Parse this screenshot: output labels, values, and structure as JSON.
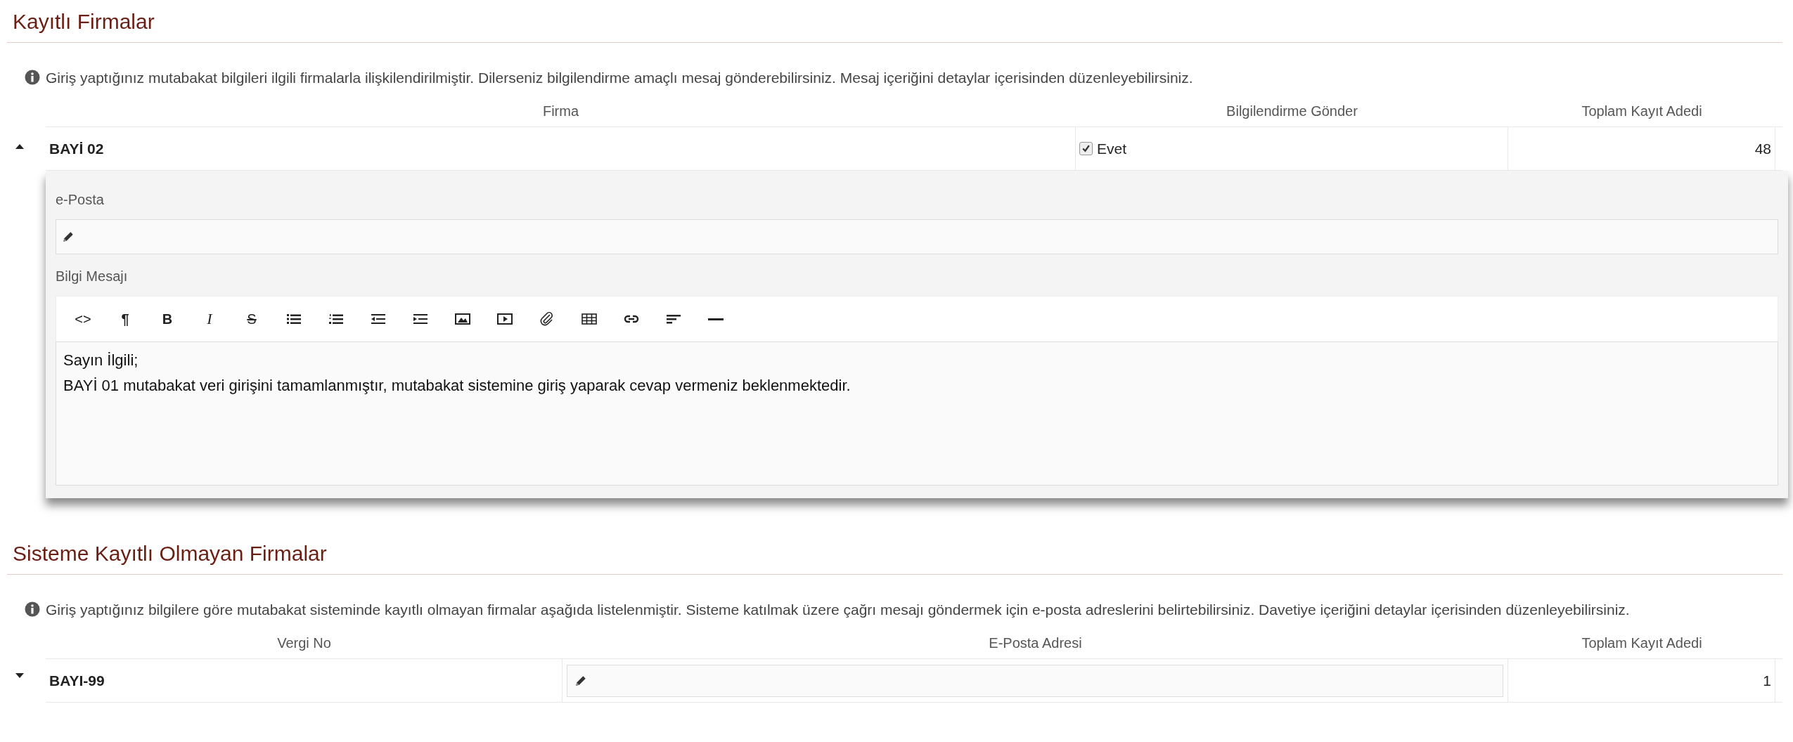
{
  "sections": [
    {
      "title": "Kayıtlı Firmalar",
      "info": "Giriş yaptığınız mutabakat bilgileri ilgili firmalarla ilişkilendirilmiştir. Dilerseniz bilgilendirme amaçlı mesaj gönderebilirsiniz. Mesaj içeriğini detaylar içerisinden düzenleyebilirsiniz.",
      "columns": [
        "Firma",
        "Bilgilendirme Gönder",
        "Toplam Kayıt Adedi"
      ],
      "rows": [
        {
          "expanded": true,
          "cells": [
            {
              "kind": "text",
              "text": "BAYİ 02"
            },
            {
              "kind": "checkbox",
              "checked": true,
              "label": "Evet"
            },
            {
              "kind": "number",
              "text": "48"
            }
          ],
          "detail": {
            "email_label": "e-Posta",
            "message_label": "Bilgi Mesajı",
            "toolbar": [
              {
                "kind": "code",
                "label": "<>"
              },
              {
                "kind": "glyph",
                "label": "¶"
              },
              {
                "kind": "bold",
                "label": "B"
              },
              {
                "kind": "italic",
                "label": "I"
              },
              {
                "kind": "strike",
                "label": "S"
              },
              {
                "kind": "bullets"
              },
              {
                "kind": "numbers"
              },
              {
                "kind": "outdent"
              },
              {
                "kind": "indent"
              },
              {
                "kind": "image"
              },
              {
                "kind": "video"
              },
              {
                "kind": "attach"
              },
              {
                "kind": "table"
              },
              {
                "kind": "link"
              },
              {
                "kind": "align"
              },
              {
                "kind": "rule"
              }
            ],
            "message": [
              "Sayın İlgili;",
              "BAYİ 01 mutabakat veri girişini tamamlanmıştır, mutabakat sistemine giriş yaparak cevap vermeniz beklenmektedir."
            ]
          }
        }
      ]
    },
    {
      "title": "Sisteme Kayıtlı Olmayan Firmalar",
      "info": "Giriş yaptığınız bilgilere göre mutabakat sisteminde kayıtlı olmayan firmalar aşağıda listelenmiştir. Sisteme katılmak üzere çağrı mesajı göndermek için e-posta adreslerini belirtebilirsiniz. Davetiye içeriğini detaylar içerisinden düzenleyebilirsiniz.",
      "columns": [
        "Vergi No",
        "E-Posta Adresi",
        "Toplam Kayıt Adedi"
      ],
      "rows": [
        {
          "expanded": false,
          "cells": [
            {
              "kind": "text",
              "text": "BAYI-99"
            },
            {
              "kind": "input"
            },
            {
              "kind": "number",
              "text": "1"
            }
          ]
        }
      ]
    }
  ]
}
